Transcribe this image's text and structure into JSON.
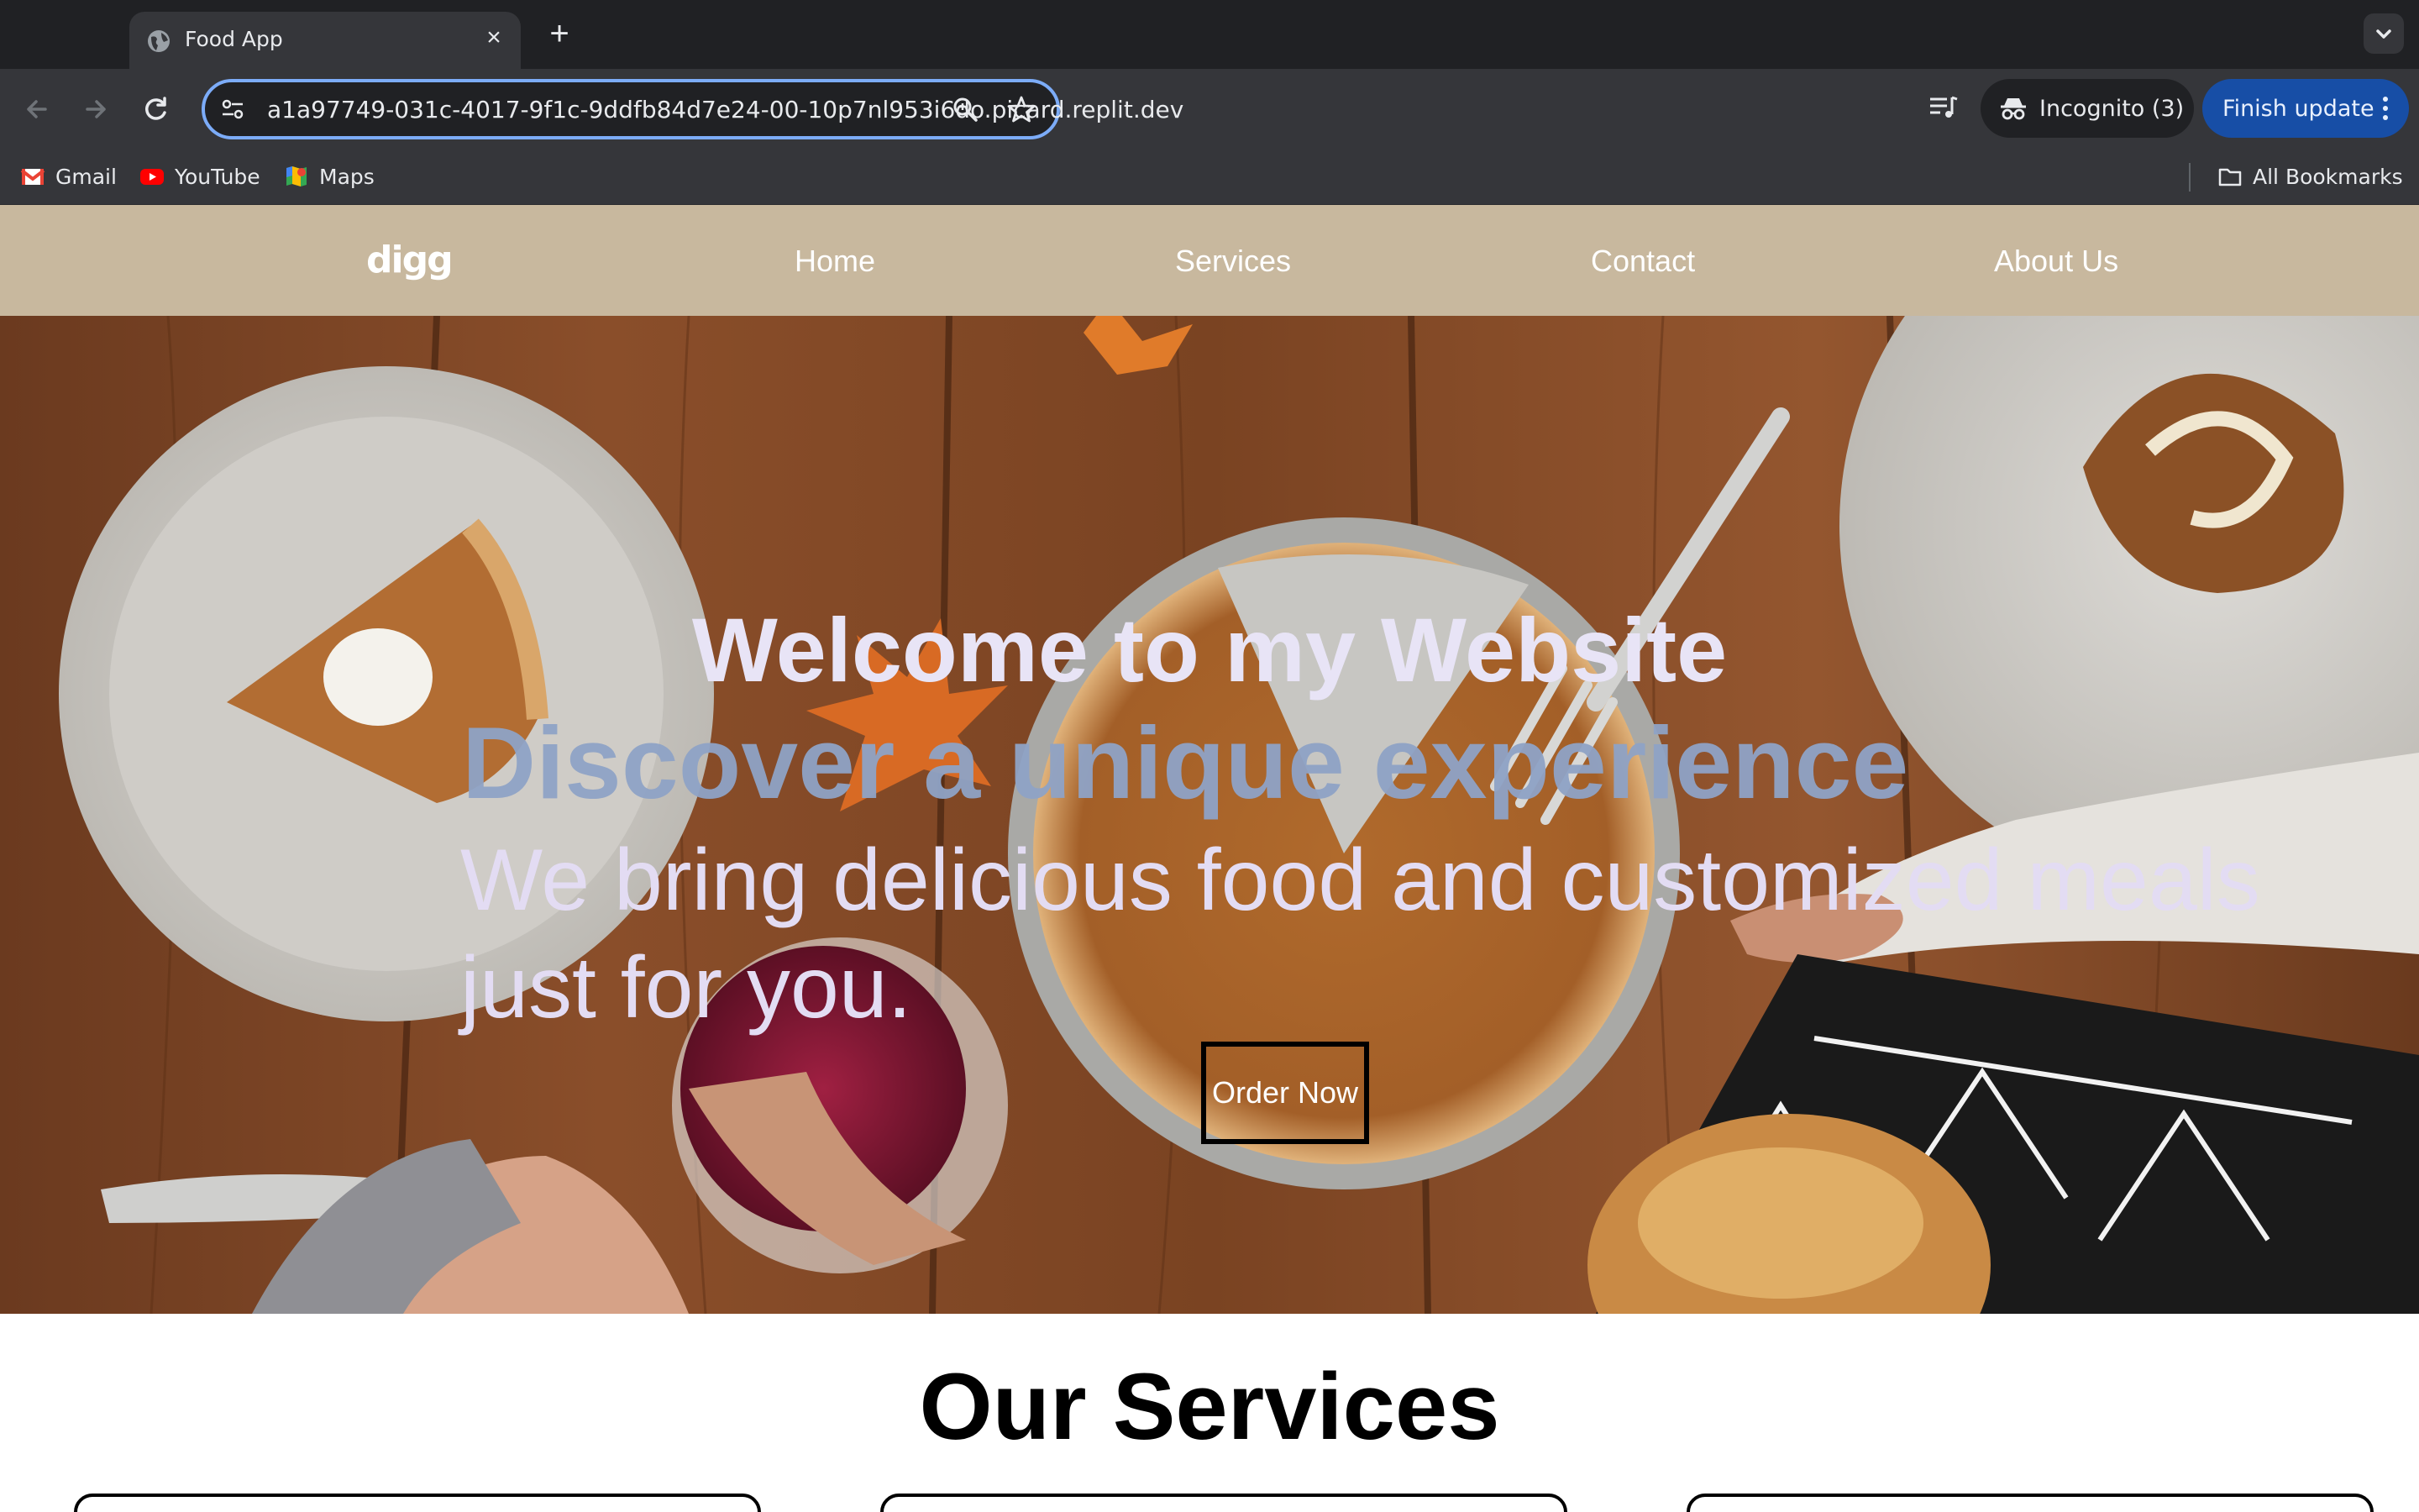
{
  "browser": {
    "tab_title": "Food App",
    "tab_close": "×",
    "new_tab": "+",
    "url": "a1a97749-031c-4017-9f1c-9ddfb84d7e24-00-10p7nl953i6do.picard.replit.dev",
    "incognito_label": "Incognito (3)",
    "update_label": "Finish update",
    "bookmarks": [
      {
        "label": "Gmail",
        "icon": "gmail-icon"
      },
      {
        "label": "YouTube",
        "icon": "youtube-icon"
      },
      {
        "label": "Maps",
        "icon": "maps-icon"
      }
    ],
    "all_bookmarks": "All Bookmarks",
    "colors": {
      "accent": "#7cacf8",
      "update": "#174ea6"
    }
  },
  "nav": {
    "logo": "digg",
    "links": [
      "Home",
      "Services",
      "Contact",
      "About Us"
    ],
    "background": "#c8b89e"
  },
  "hero": {
    "title": "Welcome to my Website",
    "subtitle": "Discover a unique experience",
    "description": "We bring delicious food and customized meals just for you.",
    "button": "Order Now"
  },
  "services": {
    "title": "Our Services"
  }
}
